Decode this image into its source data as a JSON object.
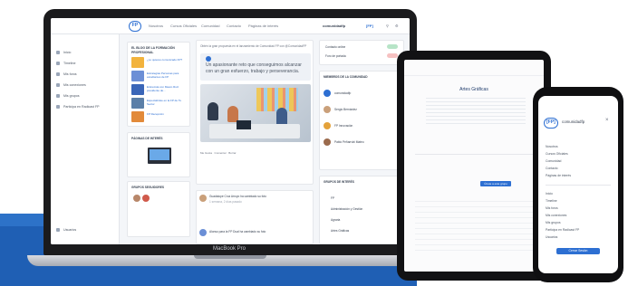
{
  "laptop": {
    "model_label": "MacBook Pro",
    "topbar": {
      "nav": [
        "Nosotros",
        "Cursos Oficiales",
        "Comunidad",
        "Contacto",
        "Páginas de interés"
      ],
      "user": "comunidadfp"
    },
    "sidebar": {
      "items": [
        "Inicio",
        "Timeline",
        "Mis foros",
        "Mis conexiones",
        "Mis grupos",
        "Participa en Radicast FP",
        "Usuarios"
      ]
    },
    "blog": {
      "title": "EL BLOG DE LA FORMACIÓN PROFESIONAL",
      "entries": [
        "¿Lo quieres comunicado FP?",
        "Estrategias Personas para estudiantes de FP",
        "Entrevista con Mauro Ruiz presidente de...",
        "Especialízate en la FP de Tu Sector",
        "FP Recepción"
      ]
    },
    "featured_label": "PÁGINAS DE INTERÉS",
    "groups_label": "GRUPOS SEGUIDORES",
    "post": {
      "header": "Obtén la gran propuesta en el lanzamiento de Comunidad FP con @ComunidadFP",
      "quote": "Un apasionante reto que conseguimos alcanzar con un gran esfuerzo, trabajo y perseverancia.",
      "actions": [
        "Me Gusta",
        "Comentar",
        "Borrar"
      ]
    },
    "post2": {
      "line1": "Guadalupe Cruz Arroyo ha cambiado su foto",
      "line2": "1 semana, 2 días pasado",
      "line3": "Alonso para la FP Dual ha cambiado su foto"
    },
    "right": {
      "online": [
        "Contacto online",
        "Foro de portada"
      ],
      "members_title": "MIEMBROS DE LA COMUNIDAD",
      "members": [
        "comunidadfp",
        "Sergio Bernárdez",
        "FP Innovación",
        "Pablo Peñarrubi Mateo"
      ],
      "groups_title": "GRUPOS DE INTERÉS",
      "groups": [
        "FP",
        "Administración y Gestión",
        "Agraria",
        "Artes Gráficas"
      ]
    }
  },
  "tablet": {
    "title": "Artes Gráficas",
    "button": "Únete a este grupo"
  },
  "phone": {
    "logo": "[FP]",
    "brand": "comunidadfp",
    "menu": [
      "Nosotros",
      "Cursos Oficiales",
      "Comunidad",
      "Contacto",
      "Páginas de interés",
      "Inicio",
      "Timeline",
      "Mis foros",
      "Mis conexiones",
      "Mis grupos",
      "Participa en Radicast FP",
      "Usuarios"
    ],
    "button": "Cerrar Sesión"
  },
  "colors": {
    "accent": "#2d6fd2",
    "band": "#1f5fb4"
  }
}
